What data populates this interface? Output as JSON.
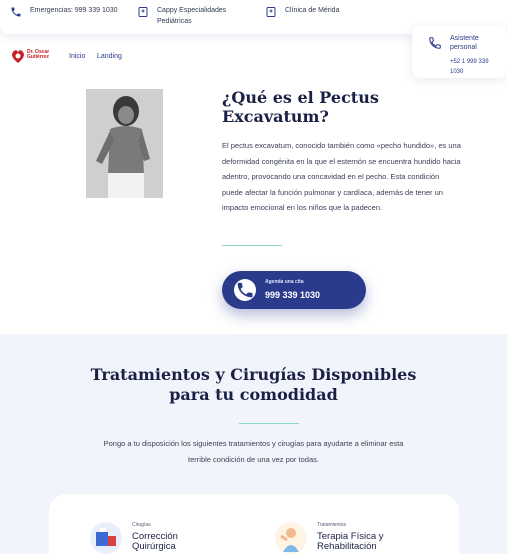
{
  "topbar": {
    "emergency": "Emergencias: 999 339 1030",
    "specialties": "Cappy Especialidades Pediátricas",
    "clinic": "Clínica de Mérida"
  },
  "brand": {
    "logo_line1": "Dr. Oscar",
    "logo_line2": "Gutiérrez",
    "logo_color": "#c8202a"
  },
  "nav": {
    "items": [
      "Inicio",
      "Landing"
    ]
  },
  "assistant": {
    "label": "Asistente personal",
    "phone": "+52 1 999 339 1030"
  },
  "hero": {
    "title": "¿Qué es el Pectus Excavatum?",
    "body": "El pectus excavatum, conocido también como «pecho hundido», es una deformidad congénita en la que el esternón se encuentra hundido hacia adentro, provocando una concavidad en el pecho. Esta condición puede afectar la función pulmonar y cardíaca, además de tener un impacto emocional en los niños que la padecen.",
    "cta_small": "Agenda una cita",
    "cta_phone": "999 339 1030"
  },
  "treatments": {
    "title": "Tratamientos y Cirugías Disponibles para tu comodidad",
    "body": "Pongo a tu disposición los siguientes tratamientos y cirugías para ayudarte a eliminar esta terrible condición de una vez por todas.",
    "cards": [
      {
        "category": "Cirugías",
        "title": "Corrección Quirúrgica"
      },
      {
        "category": "Tratamientos",
        "title": "Terapia Física y Rehabilitación"
      }
    ]
  },
  "colors": {
    "primary": "#2b3b8c",
    "accent": "#8fd6cf",
    "heading": "#1b2145"
  },
  "icons": [
    "phone-icon",
    "hospital-icon",
    "clinic-icon",
    "phone-icon"
  ]
}
